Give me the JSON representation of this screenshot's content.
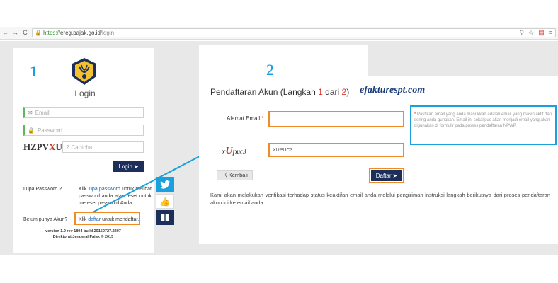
{
  "browser": {
    "back": "←",
    "forward": "→",
    "reload": "C",
    "url_scheme": "https://",
    "url_host": "ereg.pajak.go.id",
    "url_path": "/login"
  },
  "login": {
    "step_number": "1",
    "title": "Login",
    "email_placeholder": "Email",
    "password_placeholder": "Password",
    "captcha_placeholder": "Captcha",
    "login_button": "Login",
    "lupa_label": "Lupa Password ?",
    "lupa_text_prefix": "Klik ",
    "lupa_link": "lupa password",
    "lupa_text_suffix": " untuk melihat password anda atau reset untuk mereset password Anda.",
    "belum_label": "Belum punya Akun?",
    "daftar_prefix": "Klik ",
    "daftar_link": "daftar",
    "daftar_suffix": " untuk mendaftar.",
    "version": "version 1.0 rev 1804 build 20150727.2207",
    "footer": "Direktorat Jenderal Pajak © 2015"
  },
  "captcha_left": {
    "part1": "HZPV",
    "part2": "X",
    "part3": "U"
  },
  "registration": {
    "step_number": "2",
    "title_prefix": "Pendaftaran Akun  (Langkah ",
    "current_step": "1",
    "title_mid": " dari ",
    "total_steps": "2",
    "title_suffix": ")",
    "watermark": "efakturespt.com",
    "email_label": "Alamat Email",
    "required_mark": "*",
    "captcha_value": "XUPUC3",
    "info_text": "Pastikan email yang anda masukkan adalah email yang masih aktif dan sering anda gunakan. Email ini sekaligus akan menjadi email yang akan digunakan di formulir pada proses pendaftaran NPWP.",
    "kembali_button": "Kembali",
    "daftar_button": "Daftar",
    "note": "Kami akan melakukan verifikasi terhadap status keaktifan email anda melalui pengiriman instruksi langkah berikutnya dari proses pendaftaran akun ini ke email anda."
  },
  "captcha_right": {
    "part1": "x",
    "part2": "U",
    "part3": "p",
    "part4": "u",
    "part5": "c",
    "part6": "3"
  },
  "colors": {
    "accent_blue": "#1aa0dc",
    "highlight_orange": "#f08a24",
    "navy_button": "#1c2f5a"
  }
}
